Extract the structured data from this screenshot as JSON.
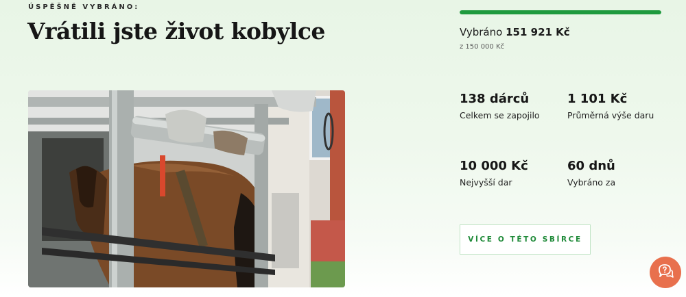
{
  "campaign": {
    "eyebrow": "ÚSPĚŠNĚ VYBRÁNO:",
    "title": "Vrátili jste život kobylce",
    "photo_icon": "horse-in-trailer-photo"
  },
  "funding": {
    "progress_fraction": 1.0,
    "raised_prefix": "Vybráno",
    "raised_amount": "151 921 Kč",
    "goal": "z 150 000 Kč"
  },
  "stats": [
    {
      "value": "138 dárců",
      "label": "Celkem se zapojilo"
    },
    {
      "value": "1 101 Kč",
      "label": "Průměrná výše daru"
    },
    {
      "value": "10 000 Kč",
      "label": "Nejvyšší dar"
    },
    {
      "value": "60 dnů",
      "label": "Vybráno za"
    }
  ],
  "actions": {
    "more_label": "VÍCE O TÉTO SBÍRCE",
    "help_icon": "help-chat-icon"
  },
  "colors": {
    "accent_green": "#1f9a3e",
    "help_orange": "#e8704d"
  }
}
